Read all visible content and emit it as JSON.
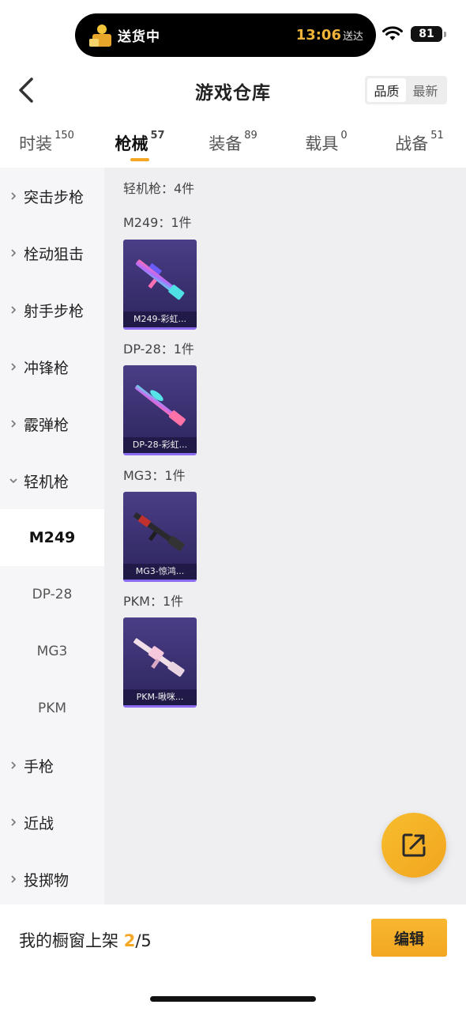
{
  "status_bar": {
    "delivery_status": "送货中",
    "eta_time": "13:06",
    "eta_suffix": "送达",
    "battery": "81"
  },
  "nav": {
    "title": "游戏仓库",
    "sort_options": [
      "品质",
      "最新"
    ],
    "sort_selected": "品质"
  },
  "tabs": [
    {
      "label": "时装",
      "count": "150"
    },
    {
      "label": "枪械",
      "count": "57",
      "active": true
    },
    {
      "label": "装备",
      "count": "89"
    },
    {
      "label": "载具",
      "count": "0"
    },
    {
      "label": "战备",
      "count": "51"
    }
  ],
  "sidebar": {
    "items": [
      {
        "label": "突击步枪"
      },
      {
        "label": "栓动狙击"
      },
      {
        "label": "射手步枪"
      },
      {
        "label": "冲锋枪"
      },
      {
        "label": "霰弹枪"
      },
      {
        "label": "轻机枪",
        "expanded": true
      },
      {
        "label": "M249",
        "sub": true,
        "selected": true
      },
      {
        "label": "DP-28",
        "sub": true
      },
      {
        "label": "MG3",
        "sub": true
      },
      {
        "label": "PKM",
        "sub": true
      },
      {
        "label": "手枪"
      },
      {
        "label": "近战"
      },
      {
        "label": "投掷物"
      }
    ]
  },
  "main": {
    "category_summary": "轻机枪：4件",
    "groups": [
      {
        "header": "M249：1件",
        "item_label": "M249-彩虹..."
      },
      {
        "header": "DP-28：1件",
        "item_label": "DP-28-彩虹..."
      },
      {
        "header": "MG3：1件",
        "item_label": "MG3-惊鸿..."
      },
      {
        "header": "PKM：1件",
        "item_label": "PKM-啾咪..."
      }
    ]
  },
  "bottom": {
    "shelf_label": "我的橱窗上架",
    "shelf_current": "2",
    "shelf_total": "/5",
    "edit_label": "编辑"
  },
  "colors": {
    "accent": "#f5a623",
    "card_bg": "#3a3070",
    "sidebar_bg": "#f6f6f8",
    "content_bg": "#efeff1"
  },
  "icons": {
    "back": "chevron-left-icon",
    "fab": "share-external-icon",
    "wifi": "wifi-icon"
  }
}
